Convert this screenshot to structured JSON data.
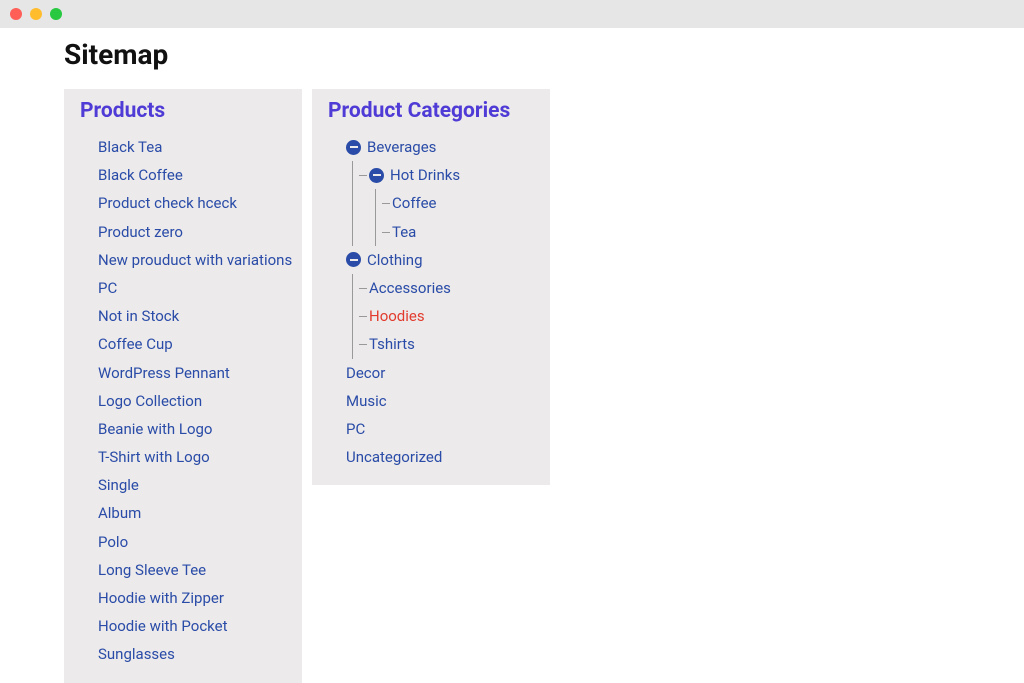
{
  "page_title": "Sitemap",
  "products_card": {
    "title": "Products",
    "items": [
      "Black Tea",
      "Black Coffee",
      "Product check hceck",
      "Product zero",
      "New prouduct with variations",
      "PC",
      "Not in Stock",
      "Coffee Cup",
      "WordPress Pennant",
      "Logo Collection",
      "Beanie with Logo",
      "T-Shirt with Logo",
      "Single",
      "Album",
      "Polo",
      "Long Sleeve Tee",
      "Hoodie with Zipper",
      "Hoodie with Pocket",
      "Sunglasses"
    ]
  },
  "categories_card": {
    "title": "Product Categories",
    "tree": [
      {
        "label": "Beverages",
        "expanded": true,
        "children": [
          {
            "label": "Hot Drinks",
            "expanded": true,
            "children": [
              {
                "label": "Coffee"
              },
              {
                "label": "Tea"
              }
            ]
          }
        ]
      },
      {
        "label": "Clothing",
        "expanded": true,
        "children": [
          {
            "label": "Accessories"
          },
          {
            "label": "Hoodies",
            "highlighted": true
          },
          {
            "label": "Tshirts"
          }
        ]
      },
      {
        "label": "Decor"
      },
      {
        "label": "Music"
      },
      {
        "label": "PC"
      },
      {
        "label": "Uncategorized"
      }
    ]
  }
}
